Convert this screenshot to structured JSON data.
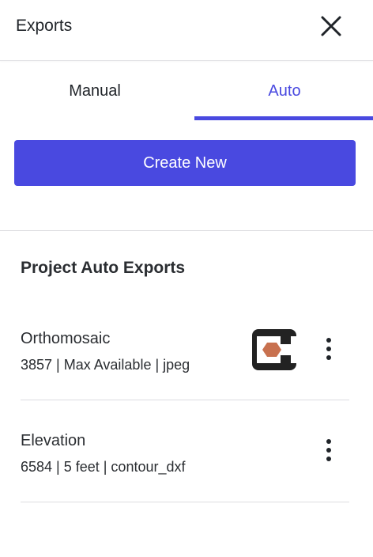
{
  "header": {
    "title": "Exports",
    "close_icon": "close-icon"
  },
  "tabs": [
    {
      "label": "Manual",
      "active": false
    },
    {
      "label": "Auto",
      "active": true
    }
  ],
  "actions": {
    "create_label": "Create New"
  },
  "section": {
    "title": "Project Auto Exports"
  },
  "exports": [
    {
      "name": "Orthomosaic",
      "meta": "3857 | Max Available | jpeg",
      "integration_icon": "integration-logo-icon",
      "menu_icon": "more-vertical-icon"
    },
    {
      "name": "Elevation",
      "meta": "6584 | 5 feet | contour_dxf",
      "menu_icon": "more-vertical-icon"
    }
  ],
  "colors": {
    "accent": "#4949e0",
    "text": "#1f2328",
    "divider": "#dcdce0",
    "logo_background": "#222222",
    "logo_hexagon": "#c8714f"
  }
}
